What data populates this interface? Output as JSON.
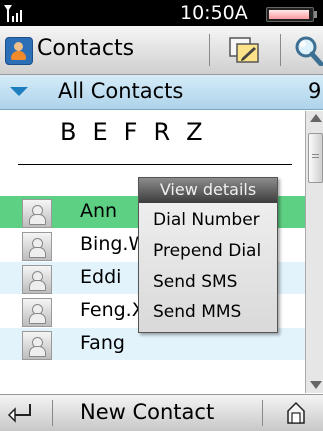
{
  "status": {
    "time": "10:50A"
  },
  "titlebar": {
    "title": "Contacts"
  },
  "group": {
    "label": "All Contacts",
    "count": "9"
  },
  "index_letters": [
    "B",
    "E",
    "F",
    "R",
    "Z"
  ],
  "contacts": [
    {
      "name": "Ann",
      "highlighted": true
    },
    {
      "name": "Bing.W",
      "highlighted": false
    },
    {
      "name": "Eddi",
      "highlighted": false
    },
    {
      "name": "Feng.Xiao",
      "highlighted": false
    },
    {
      "name": "Fang",
      "highlighted": false
    }
  ],
  "context_menu": {
    "header": "View details",
    "items": [
      "Dial Number",
      "Prepend Dial",
      "Send SMS",
      "Send MMS"
    ]
  },
  "bottombar": {
    "new_contact": "New Contact"
  },
  "colors": {
    "highlight": "#5ed083",
    "alt_row": "#e2f3fb",
    "group_bar": "#bfe0f2"
  }
}
